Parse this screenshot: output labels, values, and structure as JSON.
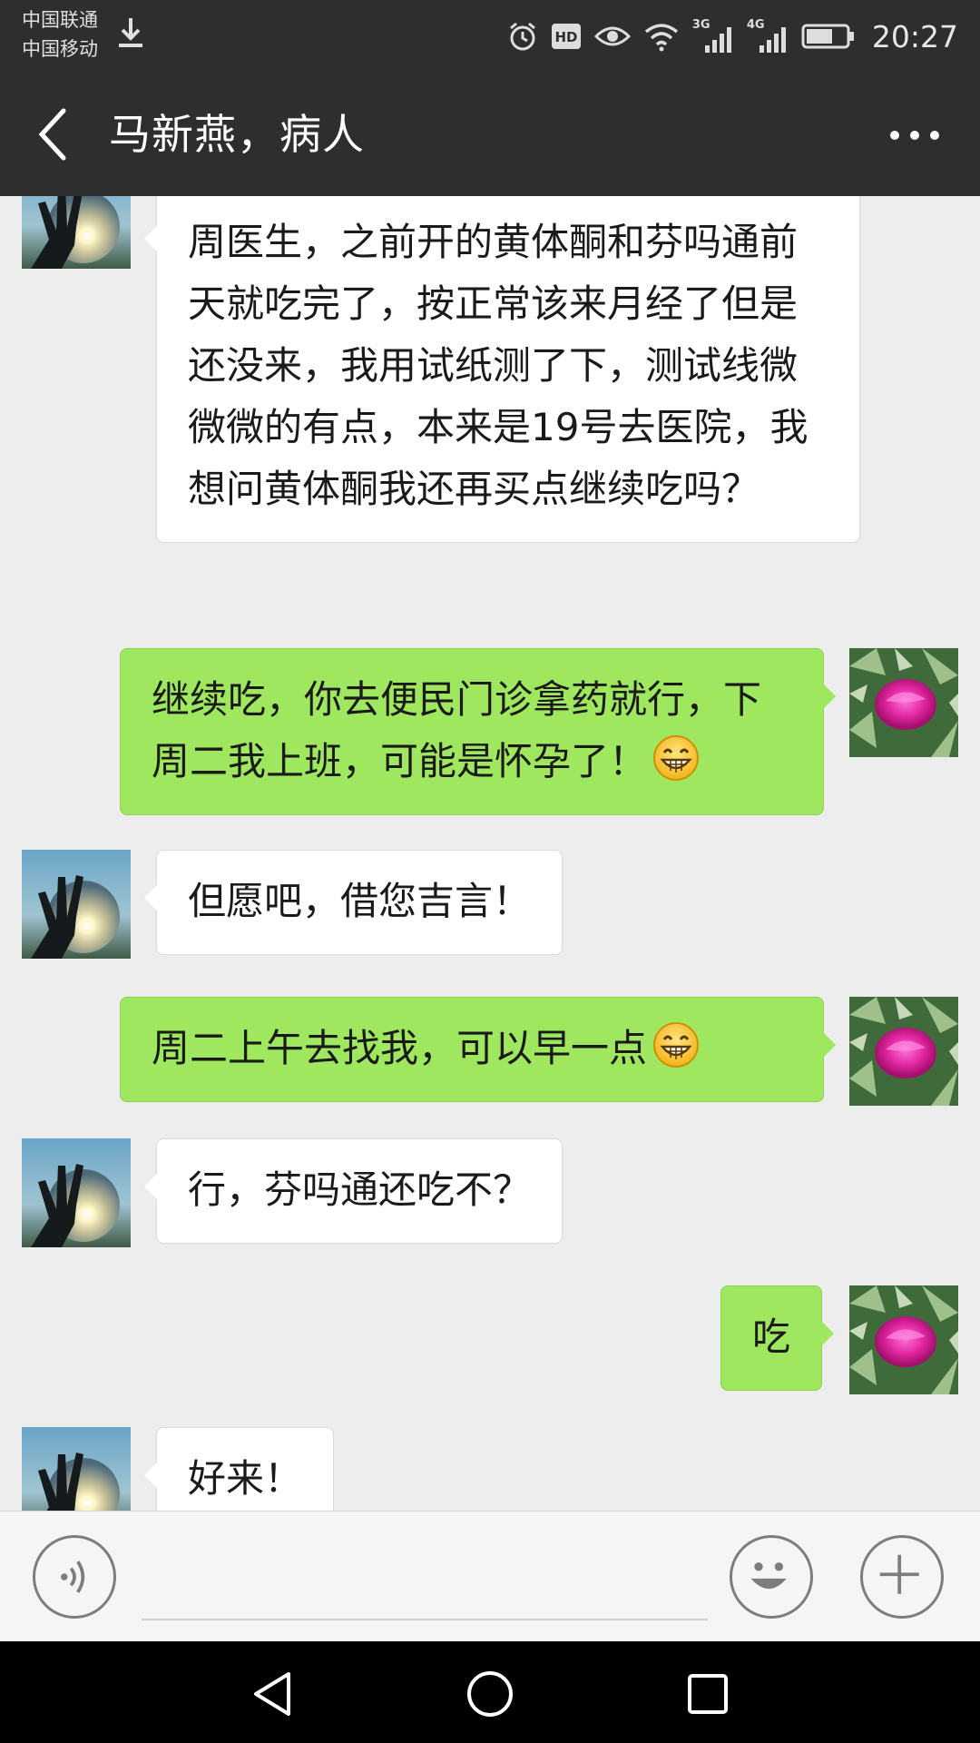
{
  "status_bar": {
    "carrier_1": "中国联通",
    "carrier_2": "中国移动",
    "network_1": "3G",
    "network_2": "4G",
    "time": "20:27"
  },
  "header": {
    "title": "马新燕，病人"
  },
  "messages": [
    {
      "side": "in",
      "text": "周医生，之前开的黄体酮和芬吗通前天就吃完了，按正常该来月经了但是还没来，我用试纸测了下，测试线微微微的有点，本来是19号去医院，我想问黄体酮我还再买点继续吃吗？"
    },
    {
      "side": "out",
      "text": "继续吃，你去便民门诊拿药就行，下周二我上班，可能是怀孕了！",
      "emoji": "grin-emoji"
    },
    {
      "side": "in",
      "text": "但愿吧，借您吉言！"
    },
    {
      "side": "out",
      "text": "周二上午去找我，可以早一点",
      "emoji": "grin-emoji"
    },
    {
      "side": "in",
      "text": "行，芬吗通还吃不？"
    },
    {
      "side": "out",
      "text": "吃"
    },
    {
      "side": "in",
      "text": "好来！"
    }
  ],
  "colors": {
    "header_bg": "#2e2e2e",
    "chat_bg": "#ededed",
    "outgoing_bubble": "#9ee75f",
    "incoming_bubble": "#ffffff"
  },
  "icons": {
    "back": "back-arrow-icon",
    "more": "more-dots-icon",
    "voice": "voice-icon",
    "emoji": "emoji-icon",
    "plus": "plus-icon"
  }
}
